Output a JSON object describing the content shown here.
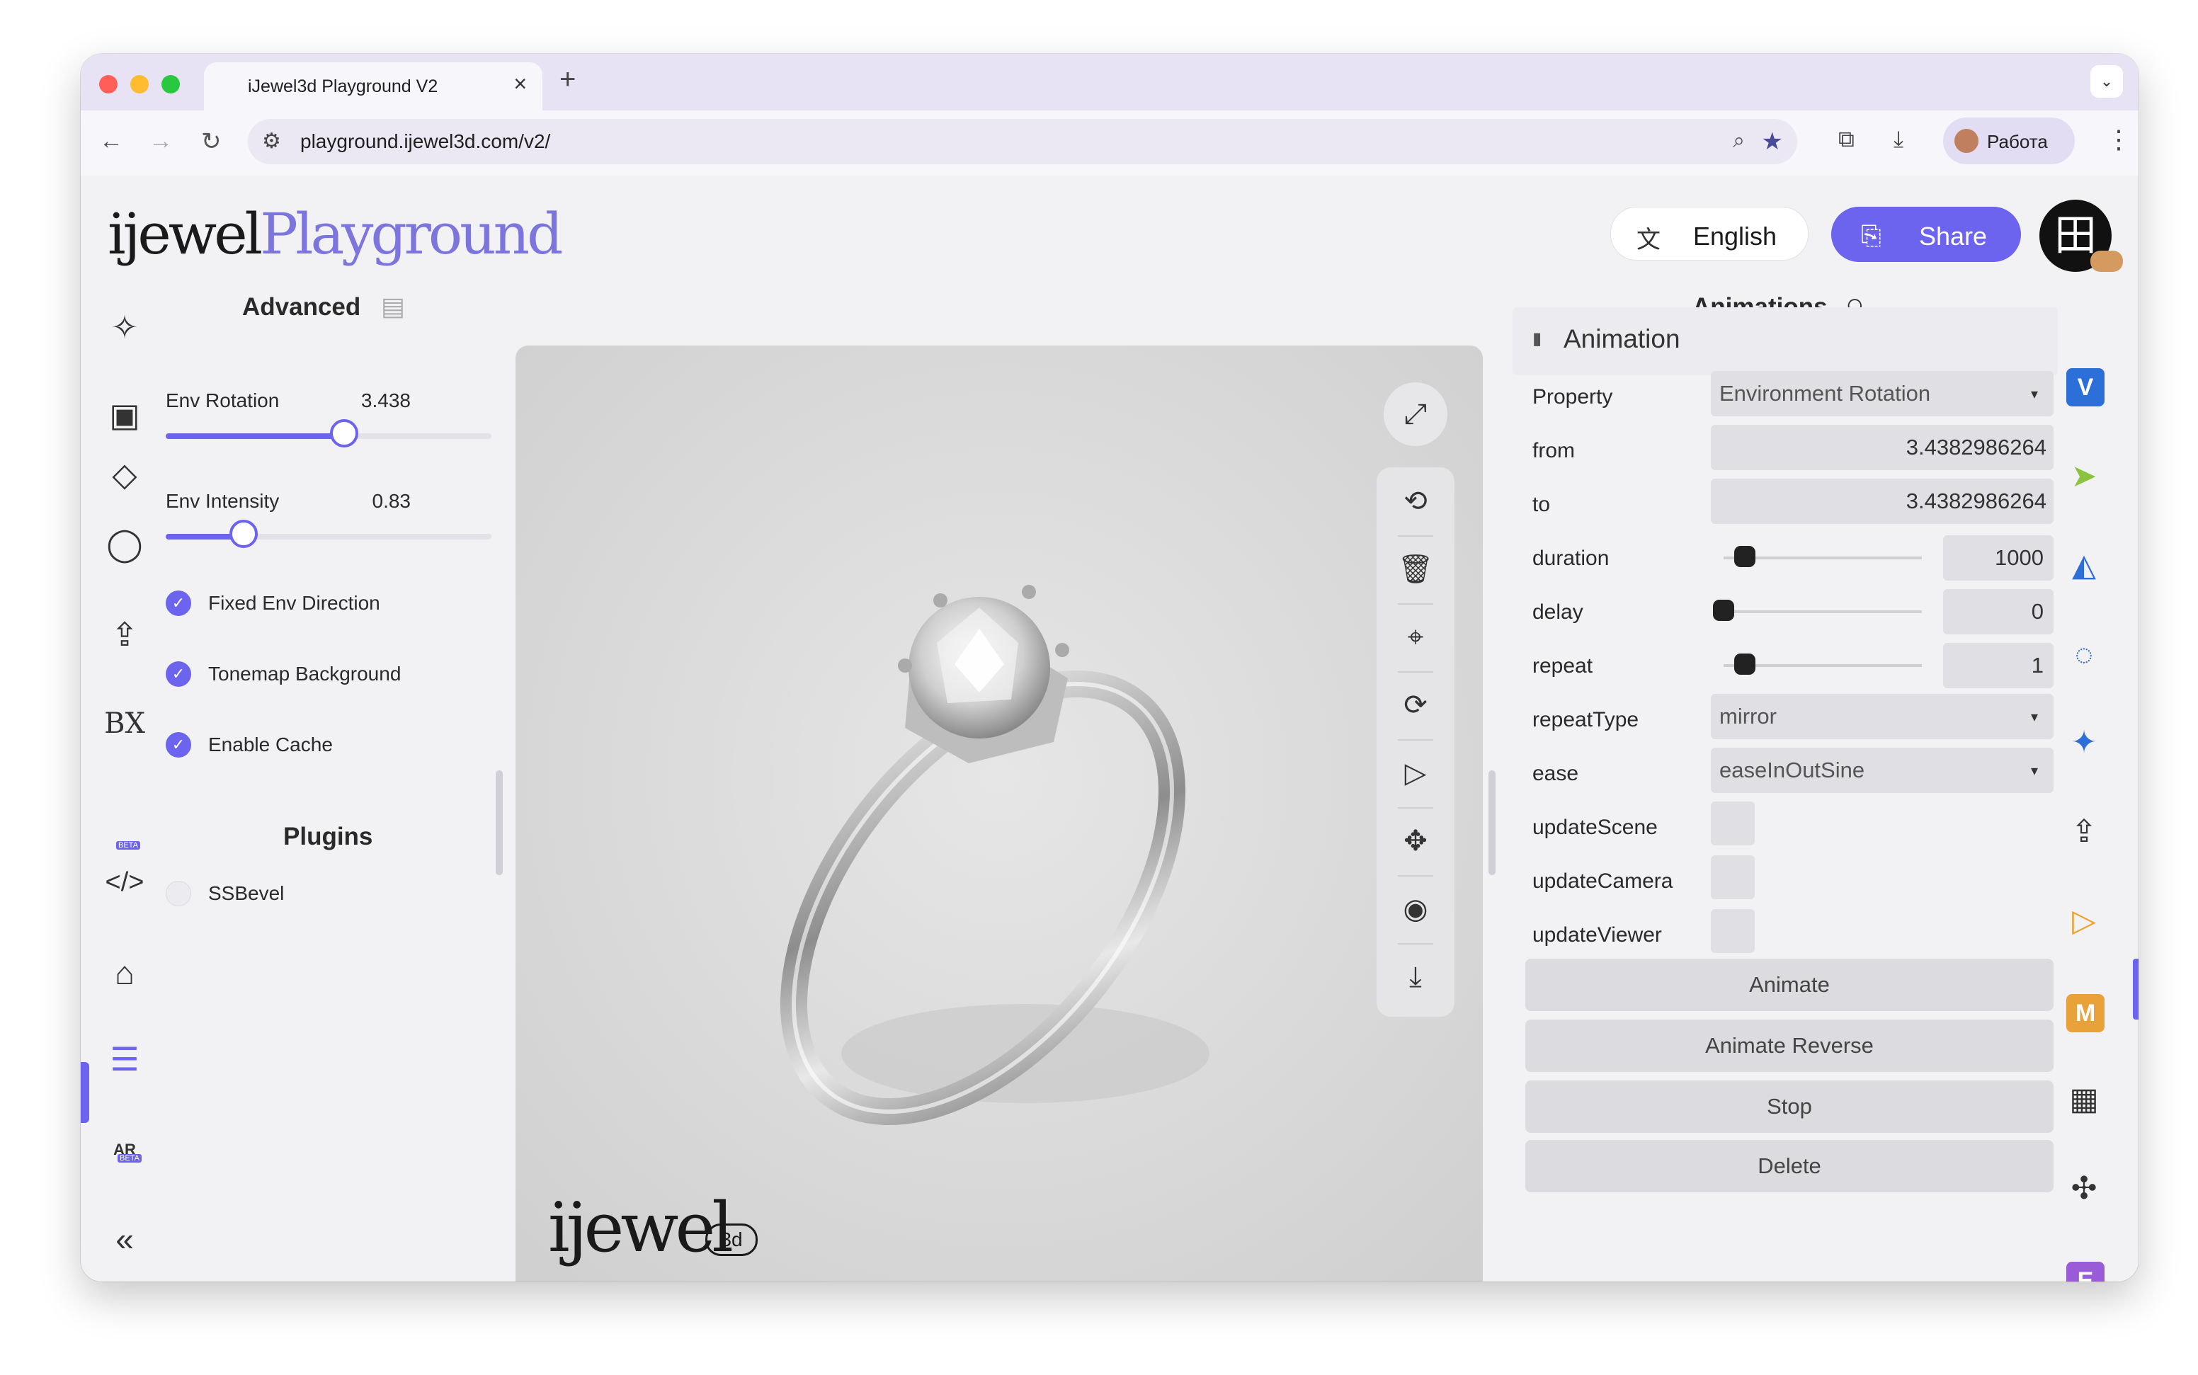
{
  "browser": {
    "tab_title": "iJewel3d Playground V2",
    "new_tab_icon": "+",
    "url": "playground.ijewel3d.com/v2/",
    "profile_name": "Работа"
  },
  "app": {
    "logo_part1": "ijewel",
    "logo_part2": "Playground",
    "language": "English",
    "share_label": "Share"
  },
  "left_panel": {
    "advanced_title": "Advanced",
    "env_rotation_label": "Env Rotation",
    "env_rotation_value": "3.438",
    "env_rotation_fraction": 0.547,
    "env_intensity_label": "Env Intensity",
    "env_intensity_value": "0.83",
    "env_intensity_fraction": 0.24,
    "fixed_env_direction": "Fixed Env Direction",
    "tonemap_background": "Tonemap Background",
    "enable_cache": "Enable Cache",
    "plugins_title": "Plugins",
    "plugin_ssbevel": "SSBevel"
  },
  "left_rail": {
    "beta_label": "BETA",
    "bx_label": "BX",
    "ar_label": "AR"
  },
  "viewport": {
    "watermark": "ijewel",
    "watermark_3d": "3d"
  },
  "right_panel": {
    "title": "Animations",
    "section": "Animation",
    "property_label": "Property",
    "property_value": "Environment Rotation",
    "from_label": "from",
    "from_value": "3.4382986264",
    "to_label": "to",
    "to_value": "3.4382986264",
    "duration_label": "duration",
    "duration_value": "1000",
    "delay_label": "delay",
    "delay_value": "0",
    "repeat_label": "repeat",
    "repeat_value": "1",
    "repeat_type_label": "repeatType",
    "repeat_type_value": "mirror",
    "ease_label": "ease",
    "ease_value": "easeInOutSine",
    "update_scene_label": "updateScene",
    "update_camera_label": "updateCamera",
    "update_viewer_label": "updateViewer",
    "animate_button": "Animate",
    "animate_reverse_button": "Animate Reverse",
    "stop_button": "Stop",
    "delete_button": "Delete"
  },
  "right_rail": {
    "badge_v": "V",
    "badge_m": "M",
    "badge_e": "E",
    "colors": {
      "v": "#2d6fd8",
      "m": "#e9a23a",
      "e": "#9a5bd8",
      "cursor": "#8ac43c",
      "play": "#f0a030",
      "accent": "#6c63ee"
    }
  }
}
